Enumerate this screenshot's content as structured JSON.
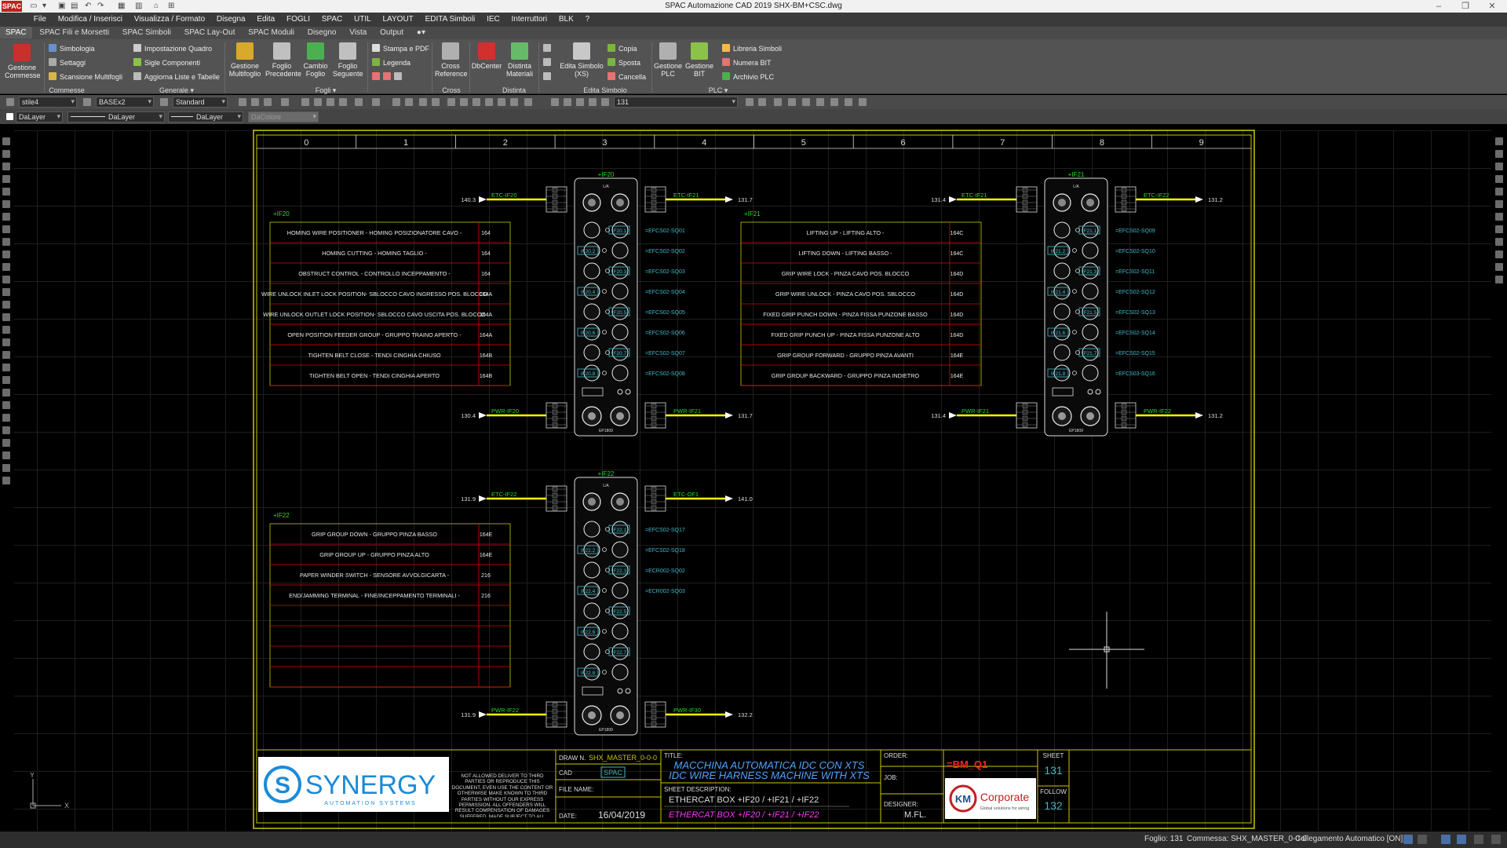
{
  "titlebar": {
    "title": "SPAC Automazione CAD 2019 SHX-BM+CSC.dwg",
    "app_badge": "SPAC"
  },
  "menu": [
    "File",
    "Modifica / Inserisci",
    "Visualizza / Formato",
    "Disegna",
    "Edita",
    "FOGLI",
    "SPAC",
    "UTIL",
    "LAYOUT",
    "EDITA Simboli",
    "IEC",
    "Interruttori",
    "BLK",
    "?"
  ],
  "tabs": [
    "SPAC",
    "SPAC Fili e Morsetti",
    "SPAC Simboli",
    "SPAC Lay-Out",
    "SPAC Moduli",
    "Disegno",
    "Vista",
    "Output"
  ],
  "ribbon": {
    "gestione_commesse": "Gestione Commesse",
    "simbologia": "Simbologia",
    "settaggi": "Settaggi",
    "scansione": "Scansione Multifogli",
    "impostazione": "Impostazione Quadro",
    "sigle": "Sigle Componenti",
    "aggiorna": "Aggiorna Liste e Tabelle",
    "gestione_multifoglio": "Gestione Multifoglio",
    "foglio_precedente": "Foglio Precedente",
    "cambio_foglio": "Cambio Foglio",
    "foglio_seguente": "Foglio Seguente",
    "stampa": "Stampa e PDF",
    "legenda": "Legenda",
    "cross_reference": "Cross Reference",
    "dbcenter": "DbCenter",
    "distinta_materiali": "Distinta Materiali",
    "edita_simbolo": "Edita Simbolo (XS)",
    "copia": "Copia",
    "sposta": "Sposta",
    "cancella": "Cancella",
    "gestione_plc": "Gestione PLC",
    "gestione_bit": "Gestione BIT",
    "libreria": "Libreria Simboli",
    "numera_bit": "Numera BIT",
    "archivio_plc": "Archivio PLC",
    "groups": [
      "Commesse",
      "Generale ▾",
      "Fogli ▾",
      "Cross",
      "Distinta",
      "Edita Simbolo",
      "PLC ▾"
    ]
  },
  "toolbar": {
    "textstyle": "stile4",
    "dimstyle": "BASEx2",
    "tablestyle": "Standard",
    "sheet_combo": "131",
    "layer": "DaLayer",
    "linetype": "DaLayer",
    "lineweight": "DaLayer",
    "color": "DaColore"
  },
  "drawing": {
    "columns": [
      "0",
      "1",
      "2",
      "3",
      "4",
      "5",
      "6",
      "7",
      "8",
      "9"
    ],
    "modules": [
      {
        "id": "+IF20",
        "etc_in_ref": "140.3",
        "etc_in": "ETC-IF20",
        "etc_out": "ETC-IF21",
        "etc_out_ref": "131.7",
        "pwr_in_ref": "130.4",
        "pwr_in": "PWR-IF20",
        "pwr_out": "PWR-IF21",
        "pwr_out_ref": "131.7"
      },
      {
        "id": "+IF21",
        "etc_in_ref": "131.4",
        "etc_in": "ETC-IF21",
        "etc_out": "ETC-IF22",
        "etc_out_ref": "131.2",
        "pwr_in_ref": "131.4",
        "pwr_in": "PWR-IF21",
        "pwr_out": "PWR-IF22",
        "pwr_out_ref": "131.2"
      },
      {
        "id": "+IF22",
        "etc_in_ref": "131.9",
        "etc_in": "ETC-IF22",
        "etc_out": "ETC-OF1",
        "etc_out_ref": "141.0",
        "pwr_in_ref": "131.9",
        "pwr_in": "PWR-IF22",
        "pwr_out": "PWR-IF30",
        "pwr_out_ref": "132.2"
      }
    ],
    "io_tables": [
      {
        "module": "+IF20",
        "rows": [
          {
            "desc": "HOMING WIRE POSITIONER - HOMING POSIZIONATORE CAVO -",
            "ref": "164",
            "tag": "IF20.1",
            "code": "=EFCS02-SQ01"
          },
          {
            "desc": "HOMING CUTTING - HOMING TAGLIO -",
            "ref": "164",
            "tag": "IF20.2",
            "code": "=EFCS02-SQ02"
          },
          {
            "desc": "OBSTRUCT CONTROL - CONTROLLO INCEPPAMENTO -",
            "ref": "164",
            "tag": "IF20.3",
            "code": "=EFCS02-SQ03"
          },
          {
            "desc": "WIRE UNLOCK INLET LOCK POSITION- SBLOCCO CAVO INGRESSO POS. BLOCCO",
            "ref": "164A",
            "tag": "IF20.4",
            "code": "=EFCS02-SQ04"
          },
          {
            "desc": "WIRE UNLOCK OUTLET LOCK POSITION- SBLOCCO CAVO USCITA POS. BLOCCO",
            "ref": "164A",
            "tag": "IF20.5",
            "code": "=EFCS02-SQ05"
          },
          {
            "desc": "OPEN POSITION FEEDER GROUP - GRUPPO TRAINO APERTO -",
            "ref": "164A",
            "tag": "IF20.6",
            "code": "=EFCS02-SQ06"
          },
          {
            "desc": "TIGHTEN BELT CLOSE - TENDI CINGHIA CHIUSO",
            "ref": "164B",
            "tag": "IF20.7",
            "code": "=EFCS02-SQ07"
          },
          {
            "desc": "TIGHTEN BELT OPEN - TENDI CINGHIA APERTO",
            "ref": "164B",
            "tag": "IF20.8",
            "code": "=EFCS02-SQ08"
          }
        ]
      },
      {
        "module": "+IF21",
        "rows": [
          {
            "desc": "LIFTING UP - LIFTING ALTO -",
            "ref": "164C",
            "tag": "IF21.1",
            "code": "=EFCS02-SQ09"
          },
          {
            "desc": "LIFTING DOWN - LIFTING BASSO -",
            "ref": "164C",
            "tag": "IF21.2",
            "code": "=EFCS02-SQ10"
          },
          {
            "desc": "GRIP WIRE LOCK - PINZA CAVO POS. BLOCCO",
            "ref": "164D",
            "tag": "IF21.3",
            "code": "=EFCS02-SQ11"
          },
          {
            "desc": "GRIP WIRE UNLOCK - PINZA CAVO POS. SBLOCCO",
            "ref": "164D",
            "tag": "IF21.4",
            "code": "=EFCS02-SQ12"
          },
          {
            "desc": "FIXED GRIP PUNCH DOWN - PINZA FISSA PUNZONE BASSO",
            "ref": "164D",
            "tag": "IF21.5",
            "code": "=EFCS02-SQ13"
          },
          {
            "desc": "FIXED GRIP PUNCH UP - PINZA FISSA PUNZONE ALTO",
            "ref": "164D",
            "tag": "IF21.6",
            "code": "=EFCS02-SQ14"
          },
          {
            "desc": "GRIP GROUP FORWARD - GRUPPO PINZA AVANTI",
            "ref": "164E",
            "tag": "IF21.7",
            "code": "=EFCS02-SQ15"
          },
          {
            "desc": "GRIP GROUP BACKWARD - GRUPPO PINZA INDIETRO",
            "ref": "164E",
            "tag": "IF21.8",
            "code": "=EFCS03-SQ16"
          }
        ]
      },
      {
        "module": "+IF22",
        "rows": [
          {
            "desc": "GRIP GROUP DOWN - GRUPPO PINZA BASSO",
            "ref": "164E",
            "tag": "IF22.1",
            "code": "=EFCS02-SQ17"
          },
          {
            "desc": "GRIP GROUP UP - GRUPPO PINZA ALTO",
            "ref": "164E",
            "tag": "IF22.2",
            "code": "=EFCS02-SQ18"
          },
          {
            "desc": "PAPER WINDER SWITCH - SENSORE AVVOLGICARTA -",
            "ref": "216",
            "tag": "IF22.3",
            "code": "=ECR002-SQ02"
          },
          {
            "desc": "END/JAMMING TERMINAL - FINE/INCEPPAMENTO TERMINALI -",
            "ref": "216",
            "tag": "IF22.4",
            "code": "=ECR002-SQ03"
          },
          {
            "desc": "",
            "ref": "",
            "tag": "IF22.5",
            "code": ""
          },
          {
            "desc": "",
            "ref": "",
            "tag": "IF22.6",
            "code": ""
          },
          {
            "desc": "",
            "ref": "",
            "tag": "IF22.7",
            "code": ""
          },
          {
            "desc": "",
            "ref": "",
            "tag": "IF22.8",
            "code": ""
          }
        ]
      }
    ],
    "titleblock": {
      "logo": "SYNERGY",
      "logo_sub": "AUTOMATION SYSTEMS",
      "notice": "NOT ALLOWED DELIVER TO THIRD PARTIES OR REPRODUCE THIS DOCUMENT, EVEN USE THE CONTENT OR OTHERWISE MAKE KNOWN TO THIRD PARTIES WITHOUT OUR EXPRESS PERMISSION. ALL OFFENDERS WILL RESULT COMPENSATION OF DAMAGES SUFFERED. MADE SUBJECT TO ALL RIGHTS UNDER PATENTS OR MODELS",
      "drawn_label": "DRAW N.",
      "drawn": "SHX_MASTER_0-0-0",
      "cad_label": "CAD",
      "cad": "SPAC",
      "file_label": "FILE NAME:",
      "date_label": "DATE:",
      "date": "16/04/2019",
      "title_label": "TITLE:",
      "title1": "MACCHINA AUTOMATICA IDC CON XTS",
      "title2": "IDC WIRE HARNESS MACHINE WITH XTS",
      "sheetdesc_label": "SHEET DESCRIPTION:",
      "sheetdesc1": "ETHERCAT BOX +IF20 / +IF21 / +IF22",
      "sheetdesc2": "ETHERCAT BOX +IF20 / +IF21 / +IF22",
      "order_label": "ORDER:",
      "order": "=BM_Q1",
      "job_label": "JOB:",
      "designer_label": "DESIGNER:",
      "designer": "M.FL.",
      "sheet_label": "SHEET",
      "sheet": "131",
      "follow_label": "FOLLOW",
      "follow": "132",
      "corp": "Corporate",
      "corp_sub": "Global solutions for wiring"
    }
  },
  "status": {
    "foglio": "Foglio: 131",
    "commessa": "Commessa: SHX_MASTER_0-0-0",
    "collegamento": "Collegamento Automatico [ON]"
  },
  "colors": {
    "frame": "#c8c800",
    "wire_yellow": "#ffff00",
    "table_red": "#e00000",
    "label_cyan": "#3fb8c8",
    "label_green": "#22dd22",
    "title_blue": "#4da3ff",
    "magenta": "#ff33ff"
  }
}
